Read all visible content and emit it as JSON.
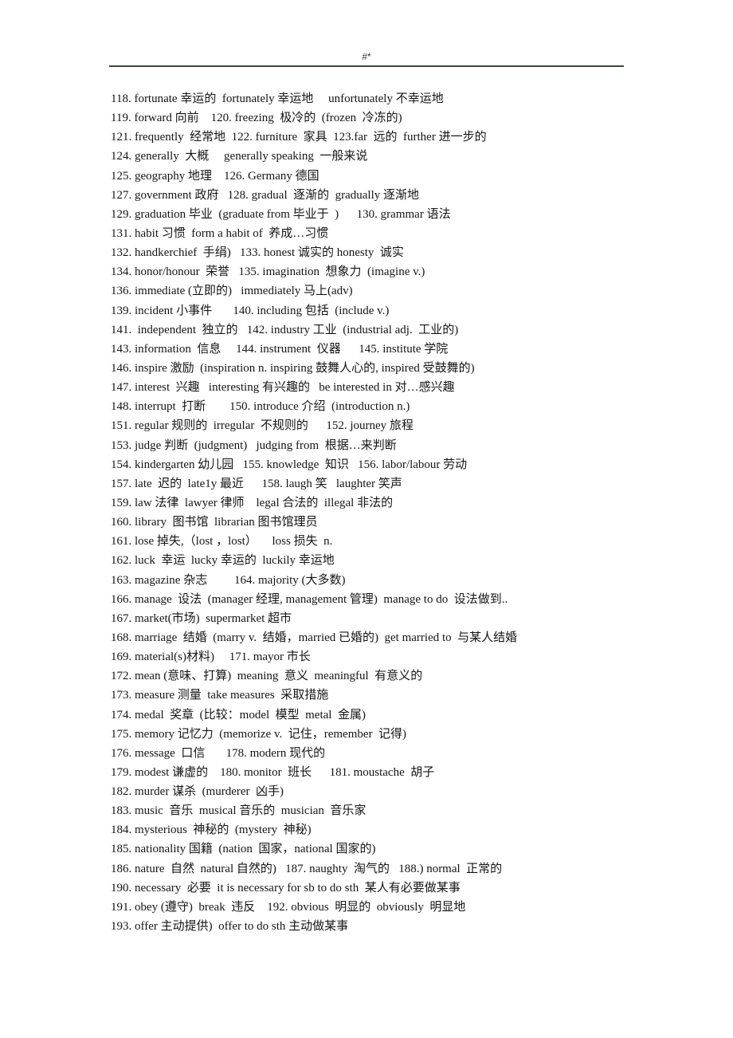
{
  "header": {
    "text": "#*"
  },
  "lines": [
    "118. fortunate 幸运的  fortunately 幸运地     unfortunately 不幸运地",
    "119. forward 向前    120. freezing  极冷的  (frozen  冷冻的)",
    "121. frequently  经常地  122. furniture  家具  123.far  远的  further 进一步的",
    "124. generally  大概     generally speaking  一般来说",
    "125. geography 地理    126. Germany 德国",
    "127. government 政府   128. gradual  逐渐的  gradually 逐渐地",
    "129. graduation 毕业  (graduate from 毕业于  )      130. grammar 语法",
    "131. habit 习惯  form a habit of  养成…习惯",
    "132. handkerchief  手绢)   133. honest 诚实的 honesty  诚实",
    "134. honor/honour  荣誉   135. imagination  想象力  (imagine v.)",
    "136. immediate (立即的)   immediately 马上(adv)",
    "139. incident 小事件       140. including 包括  (include v.)",
    "141.  independent  独立的   142. industry 工业  (industrial adj.  工业的)",
    "143. information  信息     144. instrument  仪器      145. institute 学院",
    "146. inspire 激励  (inspiration n. inspiring 鼓舞人心的, inspired 受鼓舞的)",
    "147. interest  兴趣   interesting 有兴趣的   be interested in 对…感兴趣",
    "148. interrupt  打断        150. introduce 介绍  (introduction n.)",
    "151. regular 规则的  irregular  不规则的      152. journey 旅程",
    "153. judge 判断  (judgment)   judging from  根据…来判断",
    "154. kindergarten 幼儿园   155. knowledge  知识   156. labor/labour 劳动",
    "157. late  迟的  late1y 最近      158. laugh 笑   laughter 笑声",
    "159. law 法律  lawyer 律师    legal 合法的  illegal 非法的",
    "160. library  图书馆  librarian 图书馆理员",
    "161. lose 掉失,（lost ，lost）     loss 损失  n.",
    "162. luck  幸运  lucky 幸运的  luckily 幸运地",
    "163. magazine 杂志         164. majority (大多数)",
    "166. manage  设法  (manager 经理, management 管理)  manage to do  设法做到..",
    "167. market(市场)  supermarket 超市",
    "168. marriage  结婚  (marry v.  结婚，married 已婚的)  get married to  与某人结婚",
    "169. material(s)材料)     171. mayor 市长",
    "172. mean (意味、打算)  meaning  意义  meaningful  有意义的",
    "173. measure 测量  take measures  采取措施",
    "174. medal  奖章  (比较：model  模型  metal  金属)",
    "175. memory 记忆力  (memorize v.  记住，remember  记得)",
    "176. message  口信       178. modern 现代的",
    "179. modest 谦虚的    180. monitor  班长      181. moustache  胡子",
    "182. murder 谋杀  (murderer  凶手)",
    "183. music  音乐  musical 音乐的  musician  音乐家",
    "184. mysterious  神秘的  (mystery  神秘)",
    "185. nationality 国籍  (nation  国家，national 国家的)",
    "186. nature  自然  natural 自然的)   187. naughty  淘气的   188.) normal  正常的",
    "190. necessary  必要  it is necessary for sb to do sth  某人有必要做某事",
    "191. obey (遵守)  break  违反    192. obvious  明显的  obviously  明显地",
    "193. offer 主动提供)  offer to do sth 主动做某事"
  ]
}
